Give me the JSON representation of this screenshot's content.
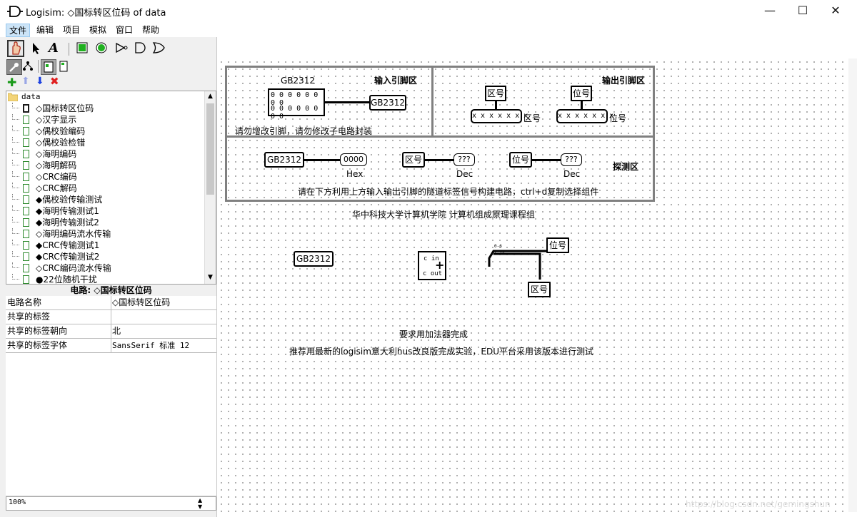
{
  "window": {
    "title": "Logisim: ◇国标转区位码 of data",
    "minimize_glyph": "—",
    "maximize_glyph": "☐",
    "close_glyph": "✕"
  },
  "menu": [
    "文件",
    "编辑",
    "项目",
    "模拟",
    "窗口",
    "帮助"
  ],
  "explorer": {
    "root": "data",
    "items": [
      "◇国标转区位码",
      "◇汉字显示",
      "◇偶校验编码",
      "◇偶校验检错",
      "◇海明编码",
      "◇海明解码",
      "◇CRC编码",
      "◇CRC解码",
      "◆偶校验传输测试",
      "◆海明传输测试1",
      "◆海明传输测试2",
      "◇海明编码流水传输",
      "◆CRC传输测试1",
      "◆CRC传输测试2",
      "◇CRC编码流水传输",
      "●22位随机干扰"
    ]
  },
  "properties": {
    "header": "电路: ◇国标转区位码",
    "rows": [
      {
        "key": "电路名称",
        "value": "◇国标转区位码"
      },
      {
        "key": "共享的标签",
        "value": ""
      },
      {
        "key": "共享的标签朝向",
        "value": "北"
      },
      {
        "key": "共享的标签字体",
        "value": "SansSerif 标准 12"
      }
    ]
  },
  "zoom": "100%",
  "circuit": {
    "input_area_title": "输入引脚区",
    "input_pin_label": "GB2312",
    "input_pin_bits_row1": "0 0 0 0 0 0 0 0",
    "input_pin_bits_row2": "0 0 0 0 0 0 0 0",
    "input_tunnel": "GB2312",
    "input_warning": "请勿增改引脚，请勿修改子电路封装",
    "output_area_title": "输出引脚区",
    "out_tunnel_qu": "区号",
    "out_tunnel_wei": "位号",
    "out_pin_bits_qu": "x x x x x x x",
    "out_pin_bits_wei": "x x x x x x x",
    "out_pin_label_qu": "区号",
    "out_pin_label_wei": "位号",
    "probe_area_title": "探测区",
    "probe_tunnel_gb": "GB2312",
    "probe_tunnel_qu": "区号",
    "probe_tunnel_wei": "位号",
    "probe_value_gb": "0000",
    "probe_value_qu": "???",
    "probe_value_wei": "???",
    "probe_radix_gb": "Hex",
    "probe_radix_qu": "Dec",
    "probe_radix_wei": "Dec",
    "probe_instruction": "请在下方利用上方输入输出引脚的隧道标签信号构建电路，ctrl+d复制选择组件",
    "credit": "华中科技大学计算机学院 计算机组成原理课程组",
    "work_tunnel_gb": "GB2312",
    "adder_cin": "c in",
    "adder_cout": "c out",
    "splitter_labels": "0-6\n7-13",
    "work_tunnel_wei": "位号",
    "work_tunnel_qu": "区号",
    "requirement": "要求用加法器完成",
    "recommendation": "推荐用最新的logisim意大利hus改良版完成实验，EDU平台采用该版本进行测试",
    "watermark": "https://blog.csdn.net/gemingshun"
  }
}
